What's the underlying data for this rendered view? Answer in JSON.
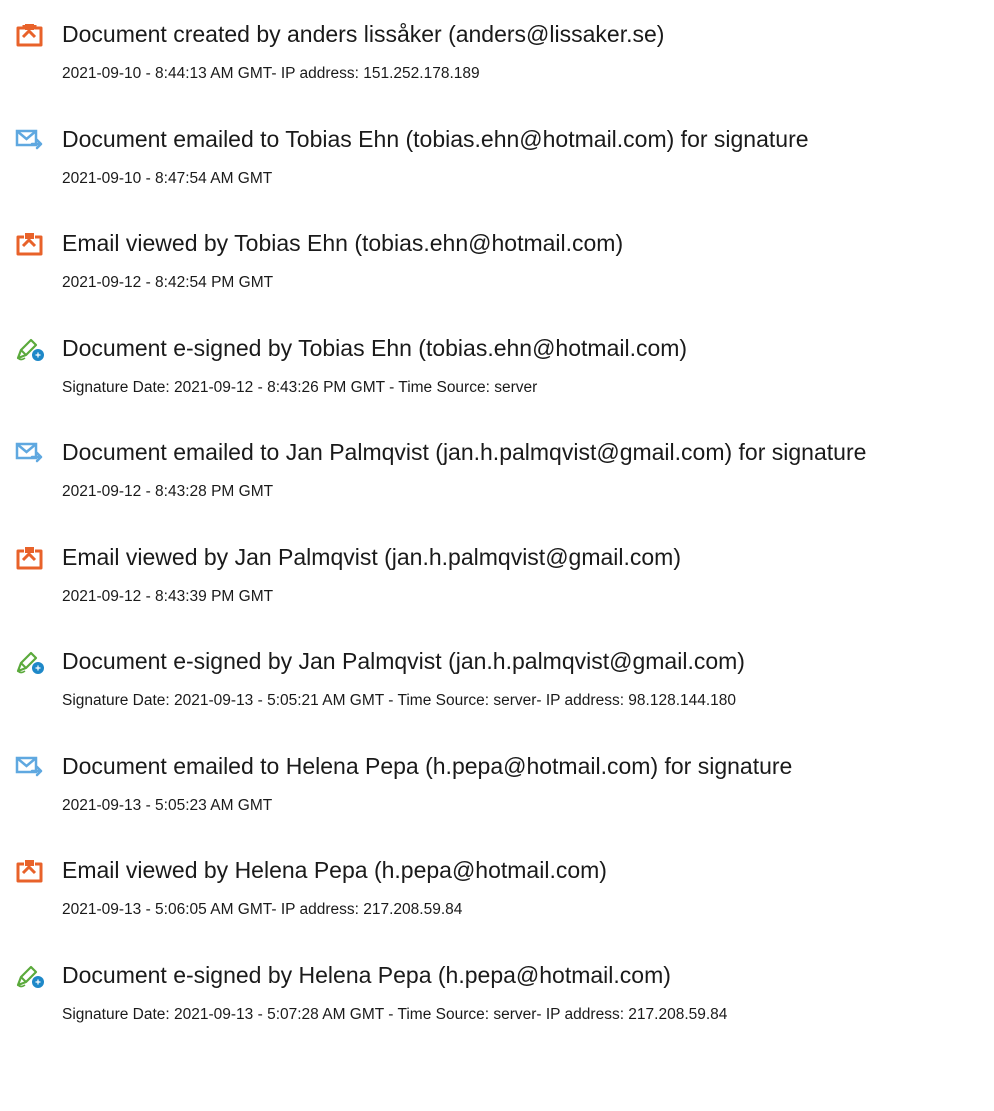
{
  "events": [
    {
      "icon": "document-created-icon",
      "title": "Document created by anders lissåker (anders@lissaker.se)",
      "detail": "2021-09-10 - 8:44:13 AM GMT- IP address: 151.252.178.189"
    },
    {
      "icon": "email-sent-icon",
      "title": "Document emailed to Tobias Ehn (tobias.ehn@hotmail.com) for signature",
      "detail": "2021-09-10 - 8:47:54 AM GMT"
    },
    {
      "icon": "document-viewed-icon",
      "title": "Email viewed by Tobias Ehn (tobias.ehn@hotmail.com)",
      "detail": "2021-09-12 - 8:42:54 PM GMT"
    },
    {
      "icon": "e-sign-pen-icon",
      "title": "Document e-signed by Tobias Ehn (tobias.ehn@hotmail.com)",
      "detail": "Signature Date: 2021-09-12 - 8:43:26 PM GMT - Time Source: server"
    },
    {
      "icon": "email-sent-icon",
      "title": "Document emailed to Jan Palmqvist (jan.h.palmqvist@gmail.com) for signature",
      "detail": "2021-09-12 - 8:43:28 PM GMT"
    },
    {
      "icon": "document-viewed-icon",
      "title": "Email viewed by Jan Palmqvist (jan.h.palmqvist@gmail.com)",
      "detail": "2021-09-12 - 8:43:39 PM GMT"
    },
    {
      "icon": "e-sign-pen-icon",
      "title": "Document e-signed by Jan Palmqvist (jan.h.palmqvist@gmail.com)",
      "detail": "Signature Date: 2021-09-13 - 5:05:21 AM GMT - Time Source: server- IP address: 98.128.144.180"
    },
    {
      "icon": "email-sent-icon",
      "title": "Document emailed to Helena Pepa (h.pepa@hotmail.com) for signature",
      "detail": "2021-09-13 - 5:05:23 AM GMT"
    },
    {
      "icon": "document-viewed-icon",
      "title": "Email viewed by Helena Pepa (h.pepa@hotmail.com)",
      "detail": "2021-09-13 - 5:06:05 AM GMT- IP address: 217.208.59.84"
    },
    {
      "icon": "e-sign-pen-icon",
      "title": "Document e-signed by Helena Pepa (h.pepa@hotmail.com)",
      "detail": "Signature Date: 2021-09-13 - 5:07:28 AM GMT - Time Source: server- IP address: 217.208.59.84"
    }
  ],
  "colors": {
    "document_icon_orange": "#E8622A",
    "email_icon_blue": "#5FA8E0",
    "pen_icon_green": "#5BAA3C",
    "pen_badge_blue": "#1E88C8",
    "text": "#1a1a1a"
  }
}
